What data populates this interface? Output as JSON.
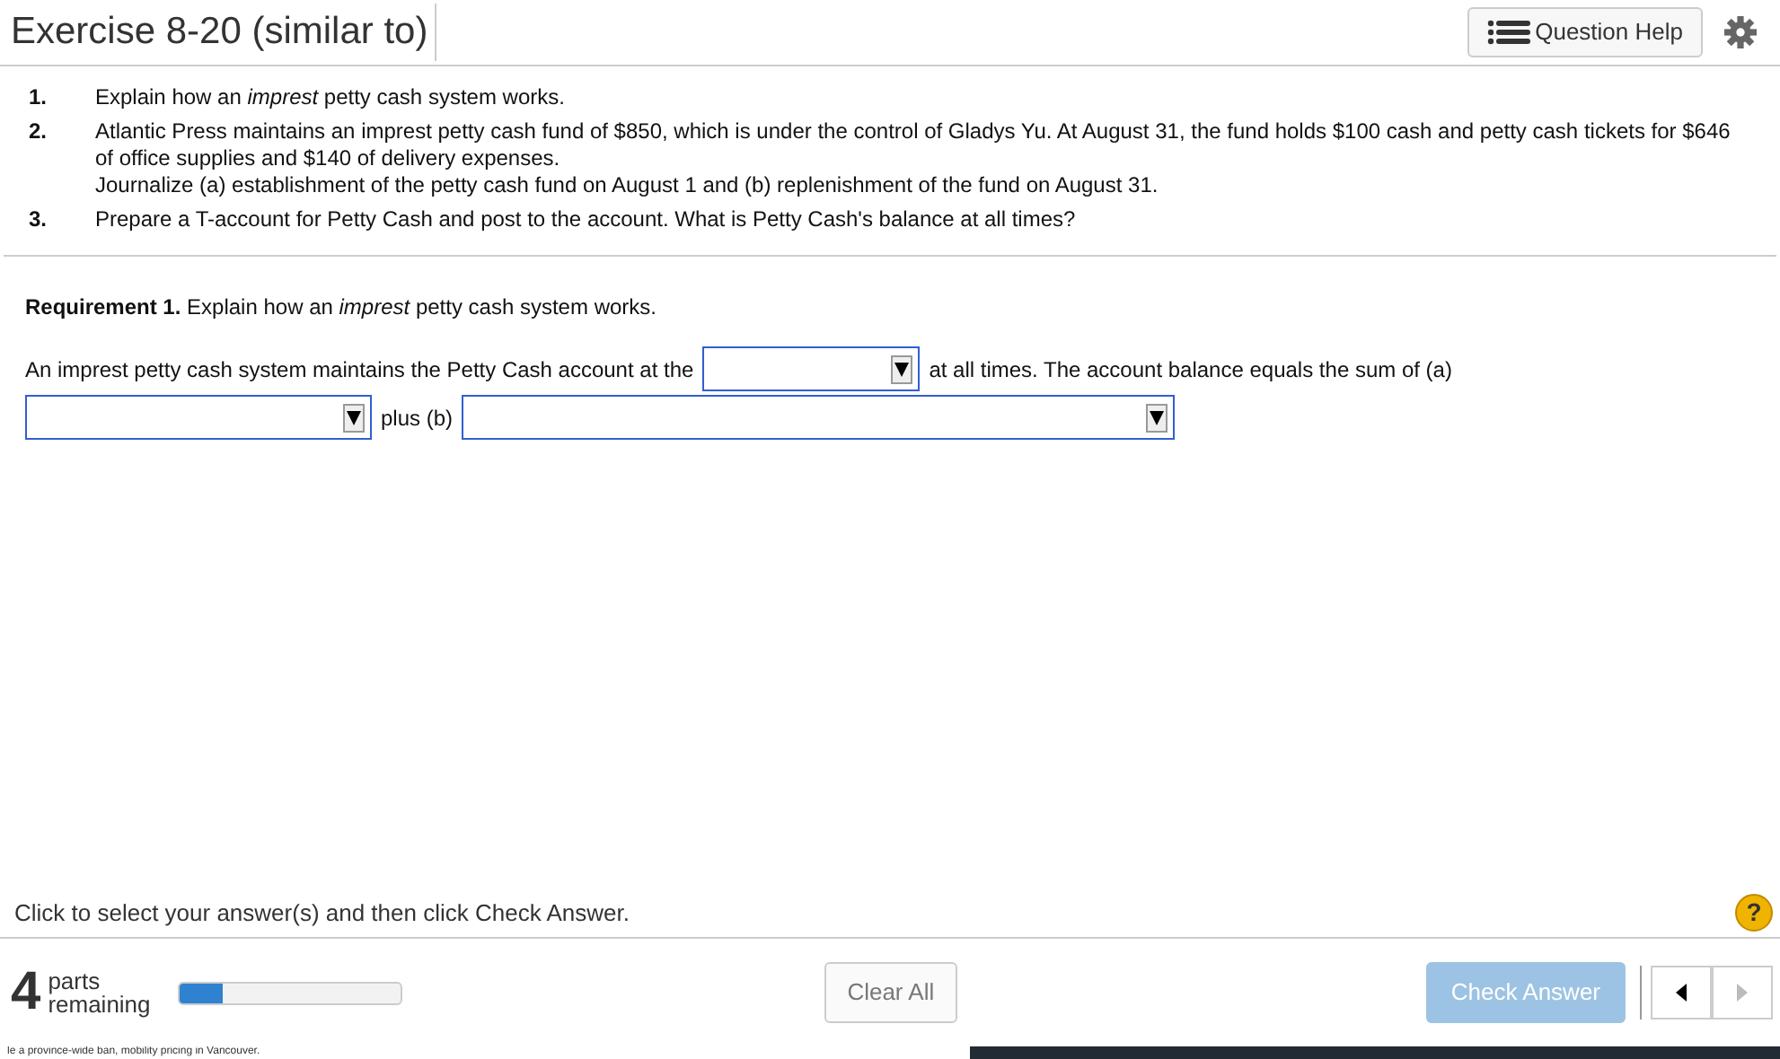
{
  "header": {
    "title": "Exercise 8-20 (similar to)",
    "help_button": "Question Help"
  },
  "questions": [
    {
      "number": "1.",
      "paragraphs": [
        "Explain how an *imprest* petty cash system works."
      ]
    },
    {
      "number": "2.",
      "paragraphs": [
        "Atlantic Press maintains an imprest petty cash fund of $850, which is under the control of Gladys Yu. At August 31, the fund holds $100 cash and petty cash tickets for $646 of office supplies and $140 of delivery expenses.",
        "Journalize (a) establishment of the petty cash fund on August 1 and (b) replenishment of the fund on August 31."
      ]
    },
    {
      "number": "3.",
      "paragraphs": [
        "Prepare a T-account for Petty Cash and post to the account. What is Petty Cash's balance at all times?"
      ]
    }
  ],
  "requirement": "**Requirement 1.** Explain how an *imprest* petty cash system works.",
  "answer": [
    {
      "kind": "text",
      "text": "An imprest petty cash system maintains the Petty Cash account at the"
    },
    {
      "kind": "select"
    },
    {
      "kind": "text",
      "text": "at all times. The account balance equals the sum of (a)"
    },
    {
      "kind": "break"
    },
    {
      "kind": "select"
    },
    {
      "kind": "text",
      "text": "plus (b)"
    },
    {
      "kind": "select"
    }
  ],
  "instruction": "Click to select your answer(s) and then click Check Answer.",
  "help_icon": "?",
  "footer": {
    "count": "4",
    "count_label": "parts remaining",
    "level": 0.2,
    "clear_button": "Clear All",
    "check_button": "Check Answer",
    "check_disabled": true,
    "prev_disabled": false,
    "next_disabled": true
  },
  "background_page": {
    "text": "le a province-wide ban, mobility pricing in Vancouver."
  }
}
